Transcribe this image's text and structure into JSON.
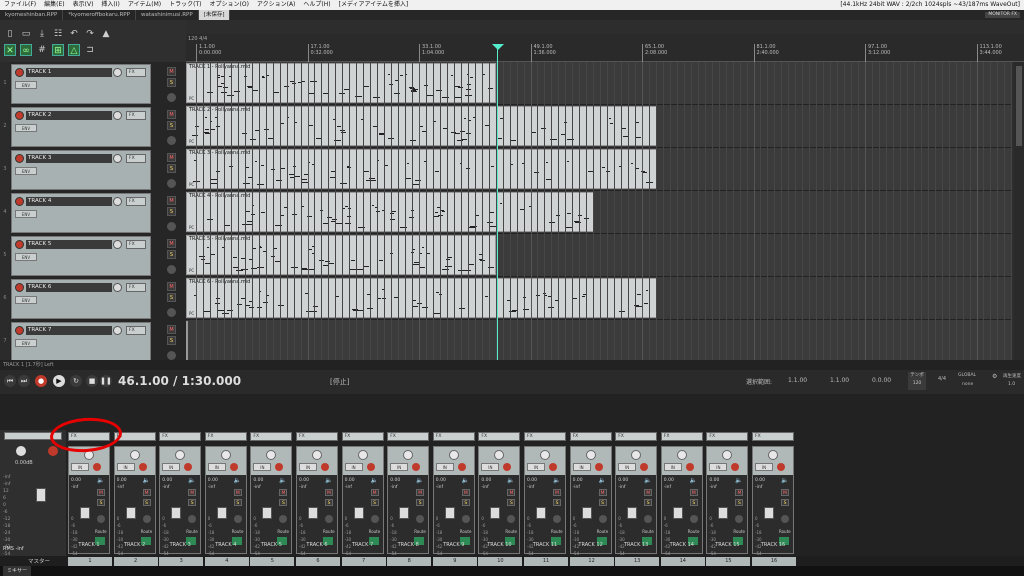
{
  "menu": {
    "items": [
      "ファイル(F)",
      "編集(E)",
      "表示(V)",
      "挿入(I)",
      "アイテム(M)",
      "トラック(T)",
      "オプション(O)",
      "アクション(A)",
      "ヘルプ(H)",
      "[メディアアイテムを挿入]"
    ],
    "status": "[44.1kHz 24bit WAV : 2/2ch 1024spls ~43/187ms WaveOut]"
  },
  "tabs": {
    "items": [
      "kyomeshinban.RPP",
      "*kyomeroffbokaru.RPP",
      "watashinimusi.RPP",
      "[未保存]"
    ],
    "active_index": 3,
    "monitor": "MONITOR FX"
  },
  "ruler": {
    "tempo_label": "120 4/4",
    "markers": [
      {
        "bar": "1.1.00",
        "time": "0:00.000"
      },
      {
        "bar": "17.1.00",
        "time": "0:32.000"
      },
      {
        "bar": "33.1.00",
        "time": "1:04.000"
      },
      {
        "bar": "49.1.00",
        "time": "1:36.000"
      },
      {
        "bar": "65.1.00",
        "time": "2:08.000"
      },
      {
        "bar": "81.1.00",
        "time": "2:40.000"
      },
      {
        "bar": "97.1.00",
        "time": "3:12.000"
      },
      {
        "bar": "113.1.00",
        "time": "3:44.000"
      }
    ]
  },
  "tracks": [
    {
      "num": "1",
      "name": "TRACK 1",
      "item": "TRACK 1 - Pollyanna.mid",
      "item_end_bar": 23
    },
    {
      "num": "2",
      "name": "TRACK 2",
      "item": "TRACK 2 - Pollyanna.mid",
      "item_end_bar": 46
    },
    {
      "num": "3",
      "name": "TRACK 3",
      "item": "TRACK 3 - Pollyanna.mid",
      "item_end_bar": 46
    },
    {
      "num": "4",
      "name": "TRACK 4",
      "item": "TRACK 4 - Pollyanna.mid",
      "item_end_bar": 37
    },
    {
      "num": "5",
      "name": "TRACK 5",
      "item": "TRACK 5 - Pollyanna.mid",
      "item_end_bar": 23
    },
    {
      "num": "6",
      "name": "TRACK 6",
      "item": "TRACK 6 - Pollyanna.mid",
      "item_end_bar": 46
    },
    {
      "num": "7",
      "name": "TRACK 7",
      "item": "",
      "item_end_bar": 0
    }
  ],
  "track_ui": {
    "fx": "FX",
    "env": "ENV",
    "m": "M",
    "s": "S",
    "pc": "PC"
  },
  "status_bar": "TRACK 1 [1.7秒] Left",
  "transport": {
    "timecode": "46.1.00 / 1:30.000",
    "state": "[停止]",
    "selection_label": "選択範囲:",
    "sel_start": "1.1.00",
    "sel_end": "1.1.00",
    "sel_len": "0.0.00",
    "tempo_label": "テンポ",
    "tempo": "120",
    "timesig": "4/4",
    "global": "GLOBAL",
    "none": "none",
    "rate_label": "再生速度",
    "rate": "1.0"
  },
  "mixer": {
    "master": {
      "db": "0.00dB",
      "rms": "RMS",
      "inf": "-inf",
      "label": "マスター",
      "scale": [
        "-inf",
        "-inf",
        "12",
        "6",
        "0",
        "-6",
        "-12",
        "-18",
        "-24",
        "-30",
        "-42",
        "-54"
      ]
    },
    "strip_common": {
      "fx": "FX",
      "io": "IN",
      "val": "0.00",
      "inf": "-inf",
      "route": "Route",
      "m": "M",
      "s": "S",
      "scale": [
        "12",
        "6",
        "0",
        "-6",
        "-18",
        "-30",
        "-42",
        "-54"
      ]
    },
    "strips": [
      "TRACK 1",
      "TRACK 2",
      "TRACK 3",
      "TRACK 4",
      "TRACK 5",
      "TRACK 6",
      "TRACK 7",
      "TRACK 8",
      "TRACK 9",
      "TRACK 10",
      "TRACK 11",
      "TRACK 12",
      "TRACK 13",
      "TRACK 14",
      "TRACK 15",
      "TRACK 16"
    ],
    "numbers": [
      "1",
      "2",
      "3",
      "4",
      "5",
      "6",
      "7",
      "8",
      "9",
      "10",
      "11",
      "12",
      "13",
      "14",
      "15",
      "16"
    ]
  },
  "bottom_tab": "ミキサー",
  "colors": {
    "accent_rec": "#c03a2b",
    "playhead": "#55eecc",
    "annotation": "#e60000",
    "panel": "#a8b1b1"
  }
}
